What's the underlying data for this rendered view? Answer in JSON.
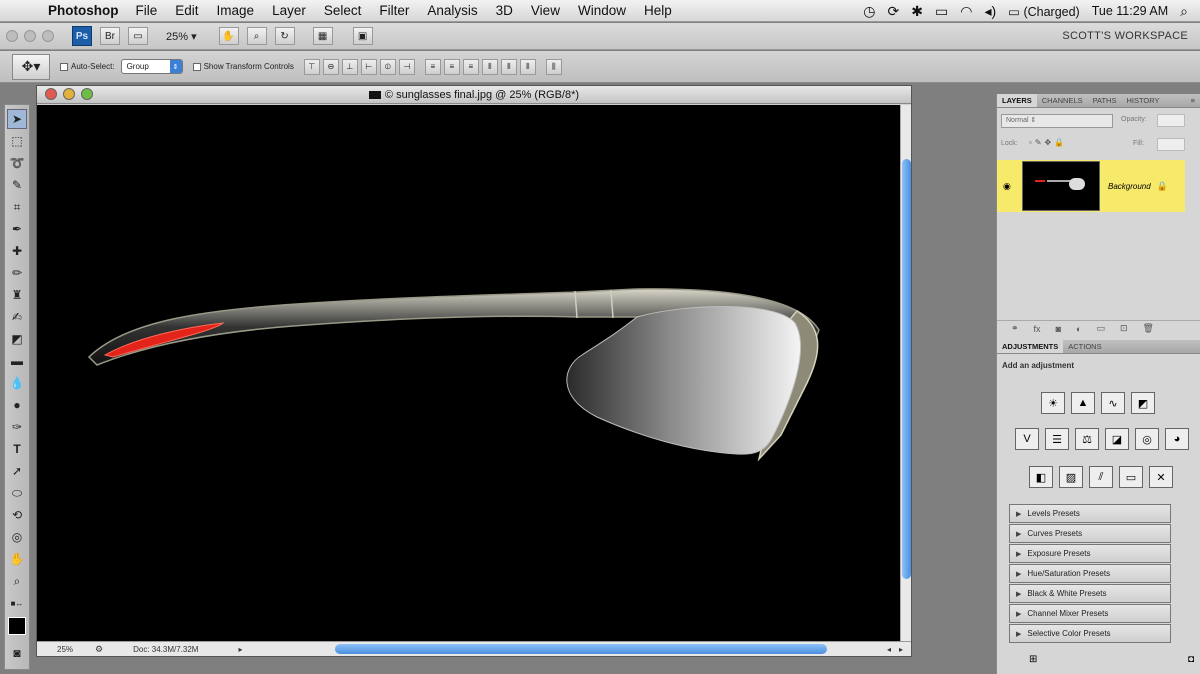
{
  "menubar": {
    "apple": "",
    "app": "Photoshop",
    "items": [
      "File",
      "Edit",
      "Image",
      "Layer",
      "Select",
      "Filter",
      "Analysis",
      "3D",
      "View",
      "Window",
      "Help"
    ],
    "battery": "(Charged)",
    "clock": "Tue 11:29 AM"
  },
  "appbar": {
    "ps_badge": "Ps",
    "zoom": "25%",
    "workspace": "SCOTT'S WORKSPACE"
  },
  "options": {
    "auto_select_label": "Auto-Select:",
    "auto_select_value": "Group",
    "transform_label": "Show Transform Controls"
  },
  "document": {
    "title": "© sunglasses final.jpg @ 25% (RGB/8*)",
    "status_zoom": "25%",
    "doc_info": "Doc: 34.3M/7.32M"
  },
  "layers_panel": {
    "tabs": [
      "LAYERS",
      "CHANNELS",
      "PATHS",
      "HISTORY"
    ],
    "blend_mode": "Normal",
    "opacity_label": "Opacity:",
    "lock_label": "Lock:",
    "fill_label": "Fill:",
    "layer_name": "Background"
  },
  "adjustments_panel": {
    "tabs": [
      "ADJUSTMENTS",
      "ACTIONS"
    ],
    "heading": "Add an adjustment",
    "presets": [
      "Levels Presets",
      "Curves Presets",
      "Exposure Presets",
      "Hue/Saturation Presets",
      "Black & White Presets",
      "Channel Mixer Presets",
      "Selective Color Presets"
    ]
  },
  "colors": {
    "layer_highlight": "#f7e96a",
    "scroll_blue": "#4a8fe0"
  }
}
